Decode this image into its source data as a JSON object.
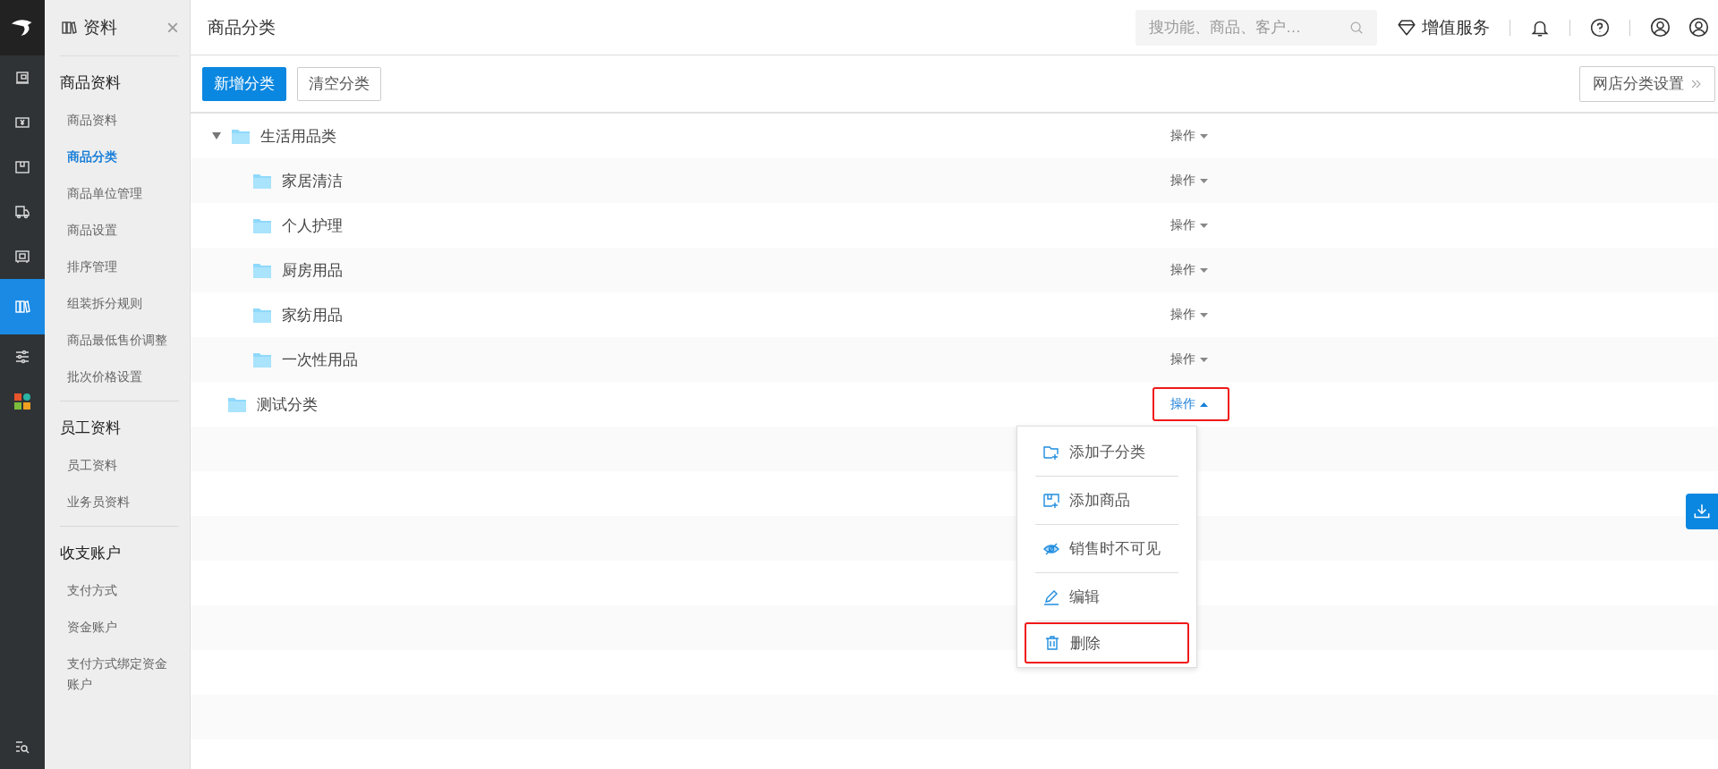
{
  "rail": {
    "items": [
      {
        "kind": "logo",
        "selected": false
      },
      {
        "kind": "board",
        "selected": false
      },
      {
        "kind": "money",
        "selected": false
      },
      {
        "kind": "box",
        "selected": false
      },
      {
        "kind": "truck",
        "selected": false
      },
      {
        "kind": "register",
        "selected": false
      },
      {
        "kind": "binders",
        "selected": true
      },
      {
        "kind": "sliders",
        "selected": false
      },
      {
        "kind": "apps",
        "selected": false
      }
    ],
    "bottom": {
      "kind": "search-list"
    }
  },
  "sidebar": {
    "title": "资料",
    "close": "×",
    "groups": [
      {
        "title": "商品资料",
        "items": [
          {
            "label": "商品资料",
            "selected": false
          },
          {
            "label": "商品分类",
            "selected": true
          },
          {
            "label": "商品单位管理",
            "selected": false
          },
          {
            "label": "商品设置",
            "selected": false
          },
          {
            "label": "排序管理",
            "selected": false
          },
          {
            "label": "组装拆分规则",
            "selected": false
          },
          {
            "label": "商品最低售价调整",
            "selected": false
          },
          {
            "label": "批次价格设置",
            "selected": false
          }
        ]
      },
      {
        "title": "员工资料",
        "items": [
          {
            "label": "员工资料",
            "selected": false
          },
          {
            "label": "业务员资料",
            "selected": false
          }
        ]
      },
      {
        "title": "收支账户",
        "items": [
          {
            "label": "支付方式",
            "selected": false
          },
          {
            "label": "资金账户",
            "selected": false
          },
          {
            "label": "支付方式绑定资金账户",
            "selected": false
          }
        ]
      }
    ]
  },
  "header": {
    "title": "商品分类",
    "search": {
      "placeholder": "搜功能、商品、客户…"
    },
    "value_service": "增值服务"
  },
  "toolbar": {
    "buttons": [
      {
        "label": "新增分类",
        "kind": "primary"
      },
      {
        "label": "清空分类",
        "kind": "default"
      }
    ],
    "shop_button": "网店分类设置"
  },
  "tree": [
    {
      "name": "生活用品类",
      "expanded": true,
      "action": {
        "label": "操作",
        "open": false,
        "highlighted": false
      },
      "children": [
        {
          "name": "家居清洁",
          "action": {
            "label": "操作",
            "open": false,
            "highlighted": false
          }
        },
        {
          "name": "个人护理",
          "action": {
            "label": "操作",
            "open": false,
            "highlighted": false
          }
        },
        {
          "name": "厨房用品",
          "action": {
            "label": "操作",
            "open": false,
            "highlighted": false
          }
        },
        {
          "name": "家纺用品",
          "action": {
            "label": "操作",
            "open": false,
            "highlighted": false
          }
        },
        {
          "name": "一次性用品",
          "action": {
            "label": "操作",
            "open": false,
            "highlighted": false
          }
        }
      ]
    },
    {
      "name": "测试分类",
      "action": {
        "label": "操作",
        "open": true,
        "highlighted": true
      }
    }
  ],
  "action_menu": {
    "items": [
      {
        "label": "添加子分类",
        "kind": "add-folder",
        "highlighted": false
      },
      {
        "label": "添加商品",
        "kind": "add-goods",
        "highlighted": false
      },
      {
        "label": "销售时不可见",
        "kind": "hide",
        "highlighted": false
      },
      {
        "label": "编辑",
        "kind": "edit",
        "highlighted": false
      },
      {
        "label": "删除",
        "kind": "delete",
        "highlighted": true
      }
    ]
  }
}
